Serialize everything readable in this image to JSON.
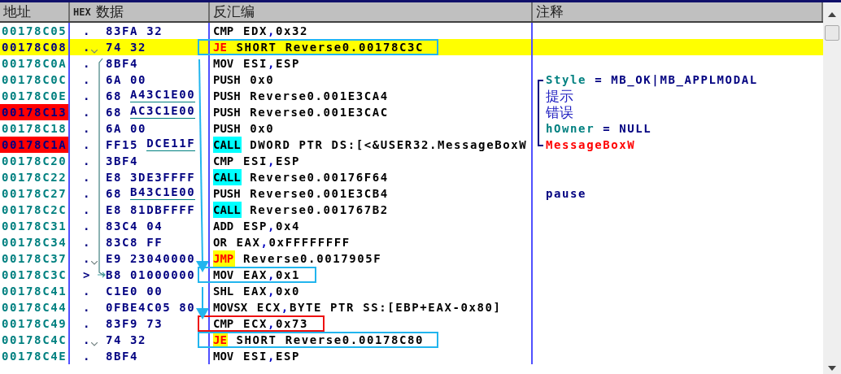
{
  "columns": [
    {
      "label": "地址"
    },
    {
      "label": "HEX",
      "label_cn": "数据"
    },
    {
      "label": "反汇编"
    },
    {
      "label": "注释"
    }
  ],
  "rows": [
    {
      "address": "00178C05",
      "selected": false,
      "breakpoint": false,
      "marker": ".",
      "hex": "83FA 32",
      "op": "CMP",
      "kind": "plain",
      "args": "EDX,0x32"
    },
    {
      "address": "00178C08",
      "selected": true,
      "breakpoint": false,
      "marker": ".",
      "jump_source": true,
      "hex": "74 32",
      "op": "JE",
      "kind": "jcc",
      "args": "SHORT Reverse0.00178C3C",
      "frame": {
        "color": "#22b5ee"
      }
    },
    {
      "address": "00178C0A",
      "selected": false,
      "breakpoint": false,
      "marker": ".",
      "hex": "8BF4",
      "op": "MOV",
      "kind": "plain",
      "args": "ESI,ESP"
    },
    {
      "address": "00178C0C",
      "selected": false,
      "breakpoint": false,
      "marker": ".",
      "hex": "6A 00",
      "op": "PUSH",
      "kind": "plain",
      "args": "0x0",
      "comment": {
        "kind": "param",
        "name": "Style",
        "value": "= MB_OK|MB_APPLMODAL",
        "bracket": {
          "kind": "top"
        }
      }
    },
    {
      "address": "00178C0E",
      "selected": false,
      "breakpoint": false,
      "marker": ".",
      "hex": "68",
      "hex_ref": "A43C1E00",
      "op": "PUSH",
      "kind": "plain",
      "args": "Reverse0.001E3CA4",
      "comment": {
        "kind": "text",
        "value": "提示",
        "bracket": {
          "kind": "mid"
        }
      }
    },
    {
      "address": "00178C13",
      "selected": false,
      "breakpoint": true,
      "marker": ".",
      "hex": "68",
      "hex_ref": "AC3C1E00",
      "op": "PUSH",
      "kind": "plain",
      "args": "Reverse0.001E3CAC",
      "comment": {
        "kind": "text",
        "value": "错误",
        "bracket": {
          "kind": "mid"
        }
      }
    },
    {
      "address": "00178C18",
      "selected": false,
      "breakpoint": false,
      "marker": ".",
      "hex": "6A 00",
      "op": "PUSH",
      "kind": "plain",
      "args": "0x0",
      "comment": {
        "kind": "param",
        "name": "hOwner",
        "value": "= NULL",
        "bracket": {
          "kind": "mid"
        }
      }
    },
    {
      "address": "00178C1A",
      "selected": false,
      "breakpoint": true,
      "marker": ".",
      "hex": "FF15",
      "hex_ref": "DCE11F",
      "op": "CALL",
      "kind": "call",
      "args": "DWORD PTR DS:[<&USER32.MessageBoxW",
      "comment": {
        "kind": "api",
        "value": "MessageBoxW",
        "bracket": {
          "kind": "bottom"
        }
      }
    },
    {
      "address": "00178C20",
      "selected": false,
      "breakpoint": false,
      "marker": ".",
      "hex": "3BF4",
      "op": "CMP",
      "kind": "plain",
      "args": "ESI,ESP"
    },
    {
      "address": "00178C22",
      "selected": false,
      "breakpoint": false,
      "marker": ".",
      "hex": "E8 3DE3FFFF",
      "op": "CALL",
      "kind": "call",
      "args": "Reverse0.00176F64"
    },
    {
      "address": "00178C27",
      "selected": false,
      "breakpoint": false,
      "marker": ".",
      "hex": "68",
      "hex_ref": "B43C1E00",
      "op": "PUSH",
      "kind": "plain",
      "args": "Reverse0.001E3CB4",
      "comment": {
        "kind": "plain",
        "value": "pause"
      }
    },
    {
      "address": "00178C2C",
      "selected": false,
      "breakpoint": false,
      "marker": ".",
      "hex": "E8 81DBFFFF",
      "op": "CALL",
      "kind": "call",
      "args": "Reverse0.001767B2"
    },
    {
      "address": "00178C31",
      "selected": false,
      "breakpoint": false,
      "marker": ".",
      "hex": "83C4 04",
      "op": "ADD",
      "kind": "plain",
      "args": "ESP,0x4"
    },
    {
      "address": "00178C34",
      "selected": false,
      "breakpoint": false,
      "marker": ".",
      "hex": "83C8 FF",
      "op": "OR",
      "kind": "plain",
      "args": "EAX,0xFFFFFFFF"
    },
    {
      "address": "00178C37",
      "selected": false,
      "breakpoint": false,
      "marker": ".",
      "jump_source": true,
      "hex": "E9 23040000",
      "op": "JMP",
      "kind": "jmp",
      "args": "Reverse0.0017905F"
    },
    {
      "address": "00178C3C",
      "selected": false,
      "breakpoint": false,
      "marker": ">",
      "jump_target": true,
      "hex": "B8 01000000",
      "op": "MOV",
      "kind": "plain",
      "args": "EAX,0x1",
      "frame": {
        "color": "#22b5ee"
      }
    },
    {
      "address": "00178C41",
      "selected": false,
      "breakpoint": false,
      "marker": ".",
      "hex": "C1E0 00",
      "op": "SHL",
      "kind": "plain",
      "args": "EAX,0x0"
    },
    {
      "address": "00178C44",
      "selected": false,
      "breakpoint": false,
      "marker": ".",
      "hex": "0FBE4C05 80",
      "op": "MOVSX",
      "kind": "plain",
      "args": "ECX,BYTE PTR SS:[EBP+EAX-0x80]"
    },
    {
      "address": "00178C49",
      "selected": false,
      "breakpoint": false,
      "marker": ".",
      "hex": "83F9 73",
      "op": "CMP",
      "kind": "plain",
      "args": "ECX,0x73",
      "frame": {
        "color": "#ee1111"
      }
    },
    {
      "address": "00178C4C",
      "selected": false,
      "breakpoint": false,
      "marker": ".",
      "jump_source": true,
      "hex": "74 32",
      "op": "JE",
      "kind": "jmp",
      "args": "SHORT Reverse0.00178C80",
      "frame": {
        "color": "#22b5ee"
      }
    },
    {
      "address": "00178C4E",
      "selected": false,
      "breakpoint": false,
      "marker": ".",
      "hex": "8BF4",
      "op": "MOV",
      "kind": "plain",
      "args": "ESI,ESP"
    }
  ]
}
